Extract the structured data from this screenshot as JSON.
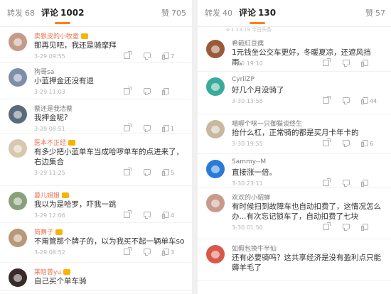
{
  "left": {
    "tabs": {
      "reposts": {
        "label": "转发",
        "count": "68"
      },
      "comments": {
        "label": "评论",
        "count": "1002"
      },
      "likes": {
        "label": "赞",
        "count": "705"
      }
    },
    "comments": [
      {
        "user": "卖狠皮的小牧童",
        "user_color": "orange",
        "vip": true,
        "text": "那再见吧，我还是骑摩拜",
        "time": "3-29 09:55",
        "likes": "7",
        "avatar_color": "#c49a8a"
      },
      {
        "user": "狗哥sa",
        "user_color": "gray",
        "vip": false,
        "text": "小蓝押金还没有退",
        "time": "3-29 11:03",
        "likes": "",
        "avatar_color": "#7d8ea8"
      },
      {
        "user": "蔡还是我洁蔡",
        "user_color": "gray",
        "vip": false,
        "text": "我押金呢?",
        "time": "3-29 08:51",
        "likes": "1",
        "avatar_color": "#5a6b7c"
      },
      {
        "user": "医本不正经",
        "user_color": "orange",
        "vip": true,
        "text": "有多少把小蓝单车当成哈啰单车的点进来了，右边集合",
        "time": "3-29 11:25",
        "likes": "5",
        "avatar_color": "#d8c8b0"
      },
      {
        "user": "曼儿姐姐",
        "user_color": "orange",
        "vip": true,
        "text": "我以为是哈罗，吓我一跳",
        "time": "3-29 12:06",
        "likes": "4",
        "avatar_color": "#8aa07a"
      },
      {
        "user": "简舞子",
        "user_color": "orange",
        "vip": true,
        "text": "不甭管那个牌子的，以为我买不起一辆单车so",
        "time": "3-29 08:52",
        "likes": "3",
        "avatar_color": "#b89878"
      },
      {
        "user": "莱晗蓉yu",
        "user_color": "orange",
        "vip": true,
        "text": "自己买个单车骑",
        "time": "",
        "likes": "",
        "avatar_color": "#3a2a2a"
      }
    ]
  },
  "right": {
    "tabs": {
      "reposts": {
        "label": "转发",
        "count": "40"
      },
      "comments": {
        "label": "评论",
        "count": "130"
      },
      "likes": {
        "label": "赞",
        "count": "57"
      }
    },
    "top_time": "4-1 13:19 今日头条",
    "comments": [
      {
        "user": "希範紅豆痍",
        "user_color": "gray",
        "vip": false,
        "text": "1元钱坐公交车更好，冬暖夏凉，还遮风挡雨。",
        "time": "3-30 19:10",
        "likes": "",
        "avatar_color": "#9a5a3a"
      },
      {
        "user": "CyrilZP",
        "user_color": "gray",
        "vip": false,
        "text": "好几个月没骑了",
        "time": "3-30 13:58",
        "likes": "44",
        "avatar_color": "#3aaa9a"
      },
      {
        "user": "喵喔个咪一只御猫谈终生",
        "user_color": "gray",
        "vip": false,
        "text": "抬什么杠，正常骑的都是买月卡年卡的",
        "time": "3-30 19:55",
        "likes": "6",
        "avatar_color": "#c8b8a0"
      },
      {
        "user": "Sammy--M",
        "user_color": "gray",
        "vip": false,
        "text": "直接涨一倍。",
        "time": "3-30 23:11",
        "likes": "",
        "avatar_color": "#2a7ad8"
      },
      {
        "user": "欢欢的小貂蝉",
        "user_color": "gray",
        "vip": false,
        "text": "有时候扫到故障车也自动扣费了，这情况怎么办...有次忘记锁车了，自动扣费了七块",
        "time": "3-30 01:50",
        "likes": "",
        "avatar_color": "#c89a8a"
      },
      {
        "user": "如假包换牛半仙",
        "user_color": "gray",
        "vip": false,
        "text": "还有必要骑吗？这共享经济是没有盈利点只能薅羊毛了",
        "time": "",
        "likes": "",
        "avatar_color": "#d8584a"
      }
    ]
  }
}
